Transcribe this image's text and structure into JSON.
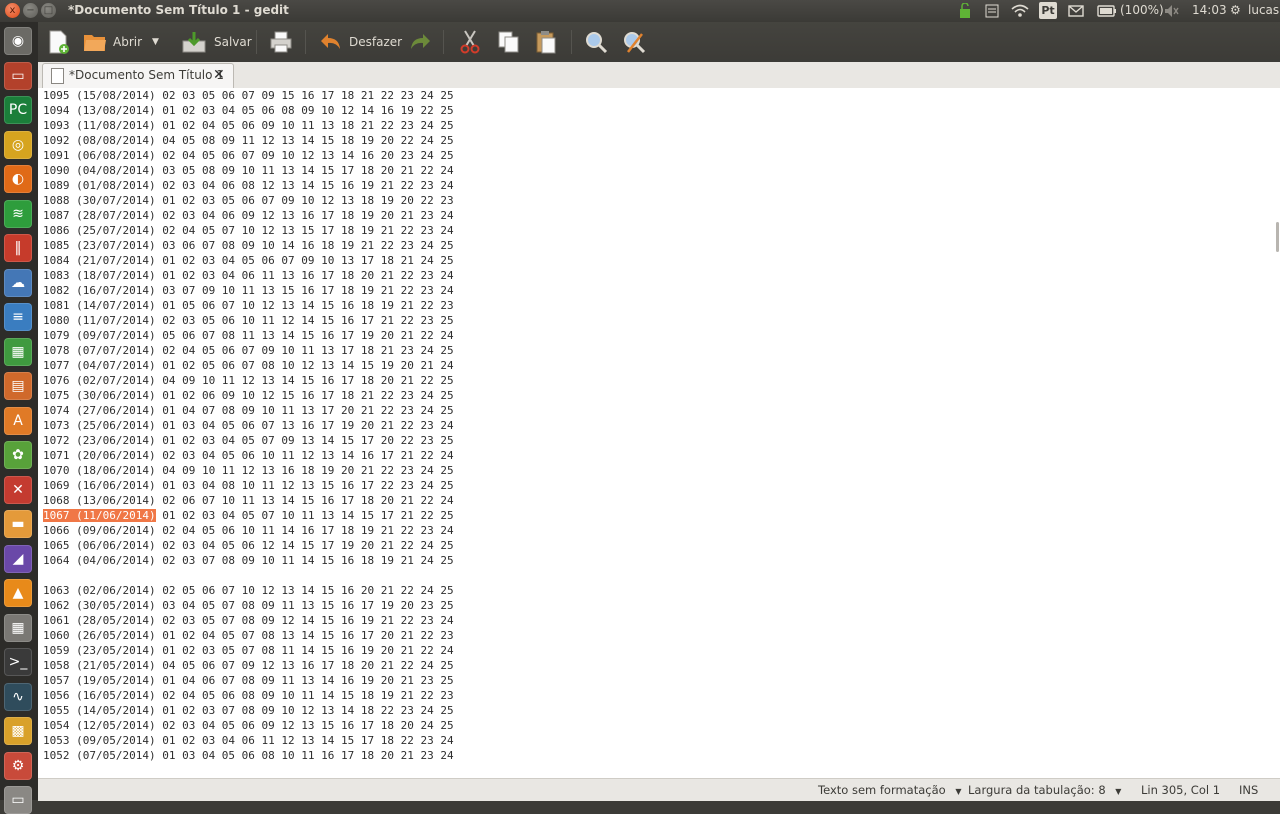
{
  "panel": {
    "window_buttons": [
      "x",
      "−",
      "□"
    ],
    "title": "*Documento Sem Título 1 - gedit",
    "indicators": {
      "keyboard": "Pt",
      "battery": "(100%)",
      "time": "14:03",
      "user": "lucas"
    }
  },
  "launcher": {
    "items": [
      {
        "name": "dash-icon",
        "glyph": "◉",
        "color": "#6b6a65"
      },
      {
        "name": "files-window-icon",
        "glyph": "▭",
        "color": "#b3412b"
      },
      {
        "name": "pycharm-icon",
        "glyph": "PC",
        "color": "#1b7f3a"
      },
      {
        "name": "chrome-icon",
        "glyph": "◎",
        "color": "#d6a41f"
      },
      {
        "name": "firefox-icon",
        "glyph": "◐",
        "color": "#e06a17"
      },
      {
        "name": "spotify-icon",
        "glyph": "≋",
        "color": "#2e9d3c"
      },
      {
        "name": "mixer-icon",
        "glyph": "‖",
        "color": "#c63b2b"
      },
      {
        "name": "cloud-icon",
        "glyph": "☁",
        "color": "#4477b6"
      },
      {
        "name": "writer-icon",
        "glyph": "≡",
        "color": "#3a7dc0"
      },
      {
        "name": "calc-icon",
        "glyph": "▦",
        "color": "#3f9a3f"
      },
      {
        "name": "impress-icon",
        "glyph": "▤",
        "color": "#d0692b"
      },
      {
        "name": "software-center-icon",
        "glyph": "A",
        "color": "#e07a26"
      },
      {
        "name": "puzzle-icon",
        "glyph": "✿",
        "color": "#58a23a"
      },
      {
        "name": "tools-icon",
        "glyph": "✕",
        "color": "#c43b30"
      },
      {
        "name": "folder-icon",
        "glyph": "▬",
        "color": "#e49a3a"
      },
      {
        "name": "editor-app-icon",
        "glyph": "◢",
        "color": "#6a48a8"
      },
      {
        "name": "vlc-icon",
        "glyph": "▲",
        "color": "#e88a1a"
      },
      {
        "name": "calculator-icon",
        "glyph": "▦",
        "color": "#7a7874"
      },
      {
        "name": "terminal-icon",
        "glyph": ">_",
        "color": "#3a3a3a"
      },
      {
        "name": "system-monitor-icon",
        "glyph": "∿",
        "color": "#2f4c5c"
      },
      {
        "name": "app-grid-icon",
        "glyph": "▩",
        "color": "#d9a12a"
      },
      {
        "name": "settings-icon",
        "glyph": "⚙",
        "color": "#c84a3a"
      },
      {
        "name": "drive-icon",
        "glyph": "▭",
        "color": "#8a8884"
      }
    ]
  },
  "toolbar": {
    "open_label": "Abrir",
    "save_label": "Salvar",
    "undo_label": "Desfazer"
  },
  "tab": {
    "label": "*Documento Sem Título 1",
    "close": "✕"
  },
  "editor": {
    "selected_text": "1067 (11/06/2014)",
    "lines": [
      "1095 (15/08/2014) 02 03 05 06 07 09 15 16 17 18 21 22 23 24 25",
      "1094 (13/08/2014) 01 02 03 04 05 06 08 09 10 12 14 16 19 22 25",
      "1093 (11/08/2014) 01 02 04 05 06 09 10 11 13 18 21 22 23 24 25",
      "1092 (08/08/2014) 04 05 08 09 11 12 13 14 15 18 19 20 22 24 25",
      "1091 (06/08/2014) 02 04 05 06 07 09 10 12 13 14 16 20 23 24 25",
      "1090 (04/08/2014) 03 05 08 09 10 11 13 14 15 17 18 20 21 22 24",
      "1089 (01/08/2014) 02 03 04 06 08 12 13 14 15 16 19 21 22 23 24",
      "1088 (30/07/2014) 01 02 03 05 06 07 09 10 12 13 18 19 20 22 23",
      "1087 (28/07/2014) 02 03 04 06 09 12 13 16 17 18 19 20 21 23 24",
      "1086 (25/07/2014) 02 04 05 07 10 12 13 15 17 18 19 21 22 23 24",
      "1085 (23/07/2014) 03 06 07 08 09 10 14 16 18 19 21 22 23 24 25",
      "1084 (21/07/2014) 01 02 03 04 05 06 07 09 10 13 17 18 21 24 25",
      "1083 (18/07/2014) 01 02 03 04 06 11 13 16 17 18 20 21 22 23 24",
      "1082 (16/07/2014) 03 07 09 10 11 13 15 16 17 18 19 21 22 23 24",
      "1081 (14/07/2014) 01 05 06 07 10 12 13 14 15 16 18 19 21 22 23",
      "1080 (11/07/2014) 02 03 05 06 10 11 12 14 15 16 17 21 22 23 25",
      "1079 (09/07/2014) 05 06 07 08 11 13 14 15 16 17 19 20 21 22 24",
      "1078 (07/07/2014) 02 04 05 06 07 09 10 11 13 17 18 21 23 24 25",
      "1077 (04/07/2014) 01 02 05 06 07 08 10 12 13 14 15 19 20 21 24",
      "1076 (02/07/2014) 04 09 10 11 12 13 14 15 16 17 18 20 21 22 25",
      "1075 (30/06/2014) 01 02 06 09 10 12 15 16 17 18 21 22 23 24 25",
      "1074 (27/06/2014) 01 04 07 08 09 10 11 13 17 20 21 22 23 24 25",
      "1073 (25/06/2014) 01 03 04 05 06 07 13 16 17 19 20 21 22 23 24",
      "1072 (23/06/2014) 01 02 03 04 05 07 09 13 14 15 17 20 22 23 25",
      "1071 (20/06/2014) 02 03 04 05 06 10 11 12 13 14 16 17 21 22 24",
      "1070 (18/06/2014) 04 09 10 11 12 13 16 18 19 20 21 22 23 24 25",
      "1069 (16/06/2014) 01 03 04 08 10 11 12 13 15 16 17 22 23 24 25",
      "1068 (13/06/2014) 02 06 07 10 11 13 14 15 16 17 18 20 21 22 24",
      "01 02 03 04 05 07 10 11 13 14 15 17 21 22 25",
      "1066 (09/06/2014) 02 04 05 06 10 11 14 16 17 18 19 21 22 23 24",
      "1065 (06/06/2014) 02 03 04 05 06 12 14 15 17 19 20 21 22 24 25",
      "1064 (04/06/2014) 02 03 07 08 09 10 11 14 15 16 18 19 21 24 25",
      "",
      "1063 (02/06/2014) 02 05 06 07 10 12 13 14 15 16 20 21 22 24 25",
      "1062 (30/05/2014) 03 04 05 07 08 09 11 13 15 16 17 19 20 23 25",
      "1061 (28/05/2014) 02 03 05 07 08 09 12 14 15 16 19 21 22 23 24",
      "1060 (26/05/2014) 01 02 04 05 07 08 13 14 15 16 17 20 21 22 23",
      "1059 (23/05/2014) 01 02 03 05 07 08 11 14 15 16 19 20 21 22 24",
      "1058 (21/05/2014) 04 05 06 07 09 12 13 16 17 18 20 21 22 24 25",
      "1057 (19/05/2014) 01 04 06 07 08 09 11 13 14 16 19 20 21 23 25",
      "1056 (16/05/2014) 02 04 05 06 08 09 10 11 14 15 18 19 21 22 23",
      "1055 (14/05/2014) 01 02 03 07 08 09 10 12 13 14 18 22 23 24 25",
      "1054 (12/05/2014) 02 03 04 05 06 09 12 13 15 16 17 18 20 24 25",
      "1053 (09/05/2014) 01 02 03 04 06 11 12 13 14 15 17 18 22 23 24",
      "1052 (07/05/2014) 01 03 04 05 06 08 10 11 16 17 18 20 21 23 24"
    ]
  },
  "statusbar": {
    "syntax": "Texto sem formatação",
    "tab_width": "Largura da tabulação: 8",
    "position": "Lin 305, Col 1",
    "mode": "INS"
  }
}
